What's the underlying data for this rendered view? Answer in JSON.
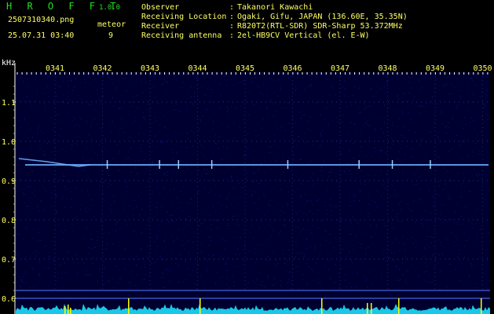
{
  "header": {
    "app_title": "H R O F F T",
    "version": "1.0.0",
    "filename": "2507310340.png",
    "meteor_label": "meteor",
    "datetime": "25.07.31 03:40",
    "meteor_count": "9"
  },
  "metadata": [
    {
      "label": "Observer",
      "value": "Takanori Kawachi"
    },
    {
      "label": "Receiving Location",
      "value": "Ogaki, Gifu, JAPAN (136.60E, 35.35N)"
    },
    {
      "label": "Receiver",
      "value": "R820T2(RTL-SDR) SDR-Sharp 53.372MHz"
    },
    {
      "label": "Receiving antenna",
      "value": "2el-HB9CV Vertical (el. E-W)"
    }
  ],
  "chart_data": {
    "type": "heatmap",
    "ylabel": "kHz",
    "x_ticks": [
      "0341",
      "0342",
      "0343",
      "0344",
      "0345",
      "0346",
      "0347",
      "0348",
      "0349",
      "0350"
    ],
    "y_ticks": [
      1.1,
      1.0,
      0.9,
      0.8,
      0.7,
      0.6
    ],
    "y_range": [
      0.6,
      1.15
    ],
    "carrier_khz": 0.94,
    "meteor_echo_minutes": [
      "0342.1",
      "0343.2",
      "0343.6",
      "0344.3",
      "0345.9",
      "0347.4",
      "0348.1",
      "0348.9"
    ],
    "colors": {
      "background": "#000030",
      "noise": "#1a1aa0",
      "signal": "#6ab0ff",
      "axis_text": "#ffff66",
      "power_trace": "#19c8e6",
      "marker": "#ffff00"
    }
  }
}
